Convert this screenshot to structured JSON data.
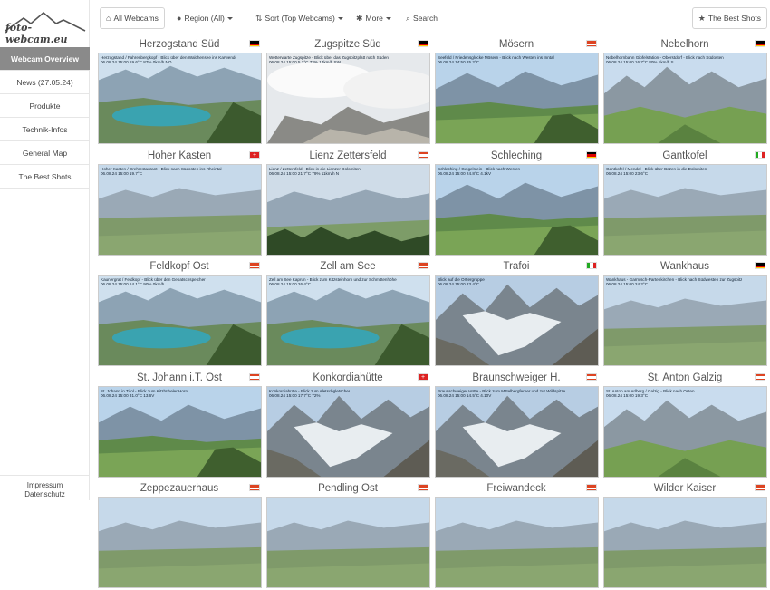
{
  "brand": {
    "logo_text": "foto-webcam.eu"
  },
  "sidebar": {
    "items": [
      {
        "label": "Webcam Overview",
        "active": true
      },
      {
        "label": "News (27.05.24)",
        "active": false
      },
      {
        "label": "Produkte",
        "active": false
      },
      {
        "label": "Technik-Infos",
        "active": false
      },
      {
        "label": "General Map",
        "active": false
      },
      {
        "label": "The Best Shots",
        "active": false
      }
    ],
    "footer": {
      "impressum": "Impressum",
      "datenschutz": "Datenschutz"
    }
  },
  "toolbar": {
    "all_webcams": "All Webcams",
    "region": "Region (All)",
    "sort": "Sort (Top Webcams)",
    "more": "More",
    "search": "Search",
    "best_shots": "The Best Shots"
  },
  "webcams": [
    {
      "name": "Herzogstand Süd",
      "flag": "de",
      "caption": "Herzogstand / Fahrenbergkopf - Blick über den Walchensee ins Karwendel",
      "stats": "06.08.24 15:00   19.6°C   87%   0km/h NO",
      "scene": "lake"
    },
    {
      "name": "Zugspitze Süd",
      "flag": "de",
      "caption": "Wetterwarte Zugspitze - Blick über das Zugspitzplatt nach Süden",
      "stats": "06.08.24 15:00   5.2°C   73%   14km/h SW",
      "scene": "clouds"
    },
    {
      "name": "Mösern",
      "flag": "at",
      "caption": "Seefeld / Friedensglocke Mösern - Blick nach Westen ins Inntal",
      "stats": "06.08.24 14:50   25.2°C",
      "scene": "valley"
    },
    {
      "name": "Nebelhorn",
      "flag": "de",
      "caption": "Nebelhornbahn Gipfelstation - Oberstdorf - Blick nach Südosten",
      "stats": "06.08.24 15:00   16.7°C   80%   1km/h S",
      "scene": "peaks"
    },
    {
      "name": "Hoher Kasten",
      "flag": "ch",
      "caption": "Hoher Kasten / Drehrestaurant - Blick nach Südosten ins Rheintal",
      "stats": "06.08.24 15:00   19.7°C",
      "scene": "plain"
    },
    {
      "name": "Lienz Zettersfeld",
      "flag": "at",
      "caption": "Lienz / Zettersfeld - Blick in die Lienzer Dolomiten",
      "stats": "06.08.24 15:00   21.7°C   79%   11km/h N",
      "scene": "forest"
    },
    {
      "name": "Schleching",
      "flag": "de",
      "caption": "Schleching / Geigelstein - Blick nach Westen",
      "stats": "06.08.24 15:00   24.8°C   4.1kV",
      "scene": "valley"
    },
    {
      "name": "Gantkofel",
      "flag": "it",
      "caption": "Gantkofel / Mendel - Blick über Bozen in die Dolomiten",
      "stats": "06.08.24 15:00   23.6°C",
      "scene": "plain"
    },
    {
      "name": "Feldkopf Ost",
      "flag": "at",
      "caption": "Kaunergrat / Feldkopf - Blick über den Gepatschspeicher",
      "stats": "06.08.24 15:00   14.1°C   90%   0km/h",
      "scene": "lake"
    },
    {
      "name": "Zell am See",
      "flag": "at",
      "caption": "Zell am See Kaprun - Blick zum Kitzsteinhorn und zur Schmittenhöhe",
      "stats": "06.08.24 15:00   26.4°C",
      "scene": "lake"
    },
    {
      "name": "Trafoi",
      "flag": "it",
      "caption": "Blick auf die Ortlergruppe",
      "stats": "06.08.24 15:00   23.4°C",
      "scene": "glacier"
    },
    {
      "name": "Wankhaus",
      "flag": "de",
      "caption": "Wankhaus - Garmisch-Partenkirchen - Blick nach Südwesten zur Zugspitze",
      "stats": "06.08.24 15:00   24.2°C",
      "scene": "plain"
    },
    {
      "name": "St. Johann i.T. Ost",
      "flag": "at",
      "caption": "St. Johann in Tirol - Blick zum Kitzbüheler Horn",
      "stats": "06.08.24 15:00   31.0°C   13.6V",
      "scene": "valley"
    },
    {
      "name": "Konkordiahütte",
      "flag": "ch",
      "caption": "Konkordiahütte - Blick zum Aletschgletscher",
      "stats": "06.08.24 15:00   17.7°C   72%",
      "scene": "glacier"
    },
    {
      "name": "Braunschweiger H.",
      "flag": "at",
      "caption": "Braunschweiger Hütte - Blick zum Mittelbergferner und zur Wildspitze",
      "stats": "06.08.24 15:00   14.5°C   4.10V",
      "scene": "glacier"
    },
    {
      "name": "St. Anton Galzig",
      "flag": "at",
      "caption": "St. Anton am Arlberg / Galzig - Blick nach Osten",
      "stats": "06.08.24 15:00   19.3°C",
      "scene": "peaks"
    },
    {
      "name": "Zeppezauerhaus",
      "flag": "at",
      "caption": "",
      "stats": "",
      "scene": "plain"
    },
    {
      "name": "Pendling Ost",
      "flag": "at",
      "caption": "",
      "stats": "",
      "scene": "plain"
    },
    {
      "name": "Freiwandeck",
      "flag": "at",
      "caption": "",
      "stats": "",
      "scene": "plain"
    },
    {
      "name": "Wilder Kaiser",
      "flag": "at",
      "caption": "",
      "stats": "",
      "scene": "plain"
    }
  ],
  "colors": {
    "accent": "#8a8a8a",
    "border": "#e6e6e6"
  },
  "icons": {
    "home": "home-icon",
    "globe": "globe-icon",
    "sort": "sort-icon",
    "gear": "gear-icon",
    "search": "search-icon",
    "star": "star-icon"
  }
}
